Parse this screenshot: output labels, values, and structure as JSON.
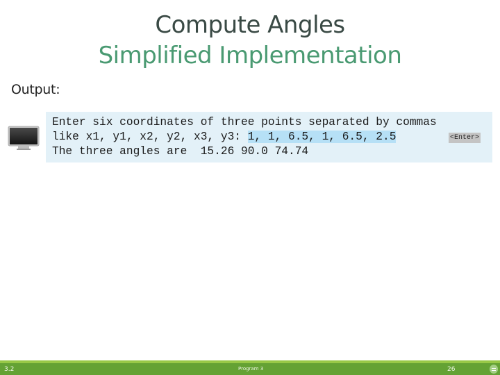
{
  "slide": {
    "title": "Compute Angles",
    "subtitle": "Simplified Implementation",
    "output_label": "Output:"
  },
  "console": {
    "line1": "Enter six coordinates of three points separated by commas",
    "line2_prompt": "like x1, y1, x2, y2, x3, y3: ",
    "line2_input": "1, 1, 6.5, 1, 6.5, 2.5",
    "enter_key": "<Enter>",
    "line3": "The three angles are  15.26 90.0 74.74",
    "colors": {
      "background": "#e3f1f8",
      "input_highlight": "#b6e0f6"
    }
  },
  "icons": {
    "monitor": "monitor-icon",
    "footer_menu": "menu-icon"
  },
  "footer": {
    "section": "3.2",
    "program": "Program 3",
    "page_number": "26",
    "colors": {
      "bar": "#64a234",
      "stripe": "#98c847"
    }
  }
}
